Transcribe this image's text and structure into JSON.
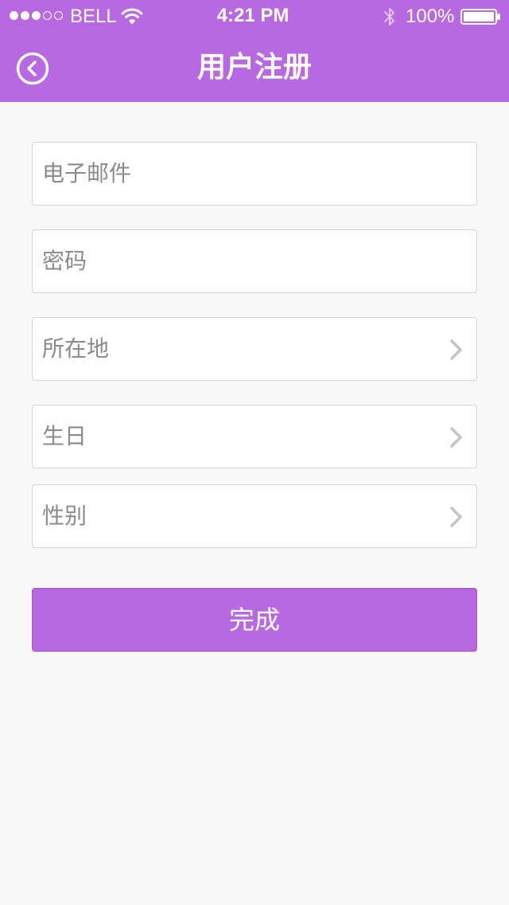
{
  "status_bar": {
    "carrier": "BELL",
    "time": "4:21 PM",
    "battery": "100%",
    "signal_bars_filled": 3,
    "signal_bars_total": 5,
    "icons": [
      "signal-dots",
      "wifi-icon",
      "bluetooth-icon",
      "battery-icon"
    ]
  },
  "nav": {
    "title": "用户注册",
    "back_icon": "back-arrow-circle-icon"
  },
  "form": {
    "email_placeholder": "电子邮件",
    "password_placeholder": "密码",
    "location_label": "所在地",
    "birthday_label": "生日",
    "gender_label": "性别",
    "chevron_icon": "chevron-right-icon"
  },
  "actions": {
    "submit_label": "完成"
  },
  "colors": {
    "accent": "#b868e0",
    "background": "#f8f8f8",
    "field_border": "#d5d5d5",
    "placeholder_text": "#8b8b8b"
  }
}
